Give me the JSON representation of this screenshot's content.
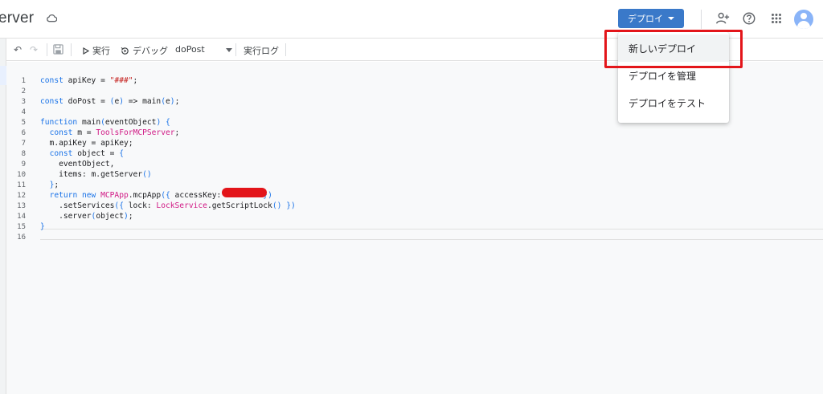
{
  "header": {
    "title": "erver",
    "deploy_label": "デプロイ",
    "icons": [
      "cloud-icon",
      "add-person-icon",
      "help-icon",
      "apps-icon",
      "avatar"
    ]
  },
  "toolbar": {
    "undo_icon": "↶",
    "redo_icon": "↷",
    "run_label": "実行",
    "debug_label": "デバッグ",
    "function_select": "doPost",
    "log_label": "実行ログ"
  },
  "editor": {
    "line_numbers": [
      "1",
      "2",
      "3",
      "4",
      "5",
      "6",
      "7",
      "8",
      "9",
      "10",
      "11",
      "12",
      "13",
      "14",
      "15",
      "16"
    ],
    "lines": [
      "const apiKey = \"###\";",
      "",
      "const doPost = (e) => main(e);",
      "",
      "function main(eventObject) {",
      "  const m = ToolsForMCPServer;",
      "  m.apiKey = apiKey;",
      "  const object = {",
      "    eventObject,",
      "    items: m.getServer()",
      "  };",
      "  return new MCPApp.mcpApp({ accessKey:         })",
      "    .setServices({ lock: LockService.getScriptLock() })",
      "    .server(object);",
      "}",
      ""
    ]
  },
  "menu": {
    "items": [
      {
        "label": "新しいデプロイ"
      },
      {
        "label": "デプロイを管理"
      },
      {
        "label": "デプロイをテスト"
      }
    ]
  },
  "colors": {
    "deploy_button": "#3a79c9",
    "highlight": "#e3151a",
    "keyword": "#1a73e8",
    "class": "#d01884"
  }
}
